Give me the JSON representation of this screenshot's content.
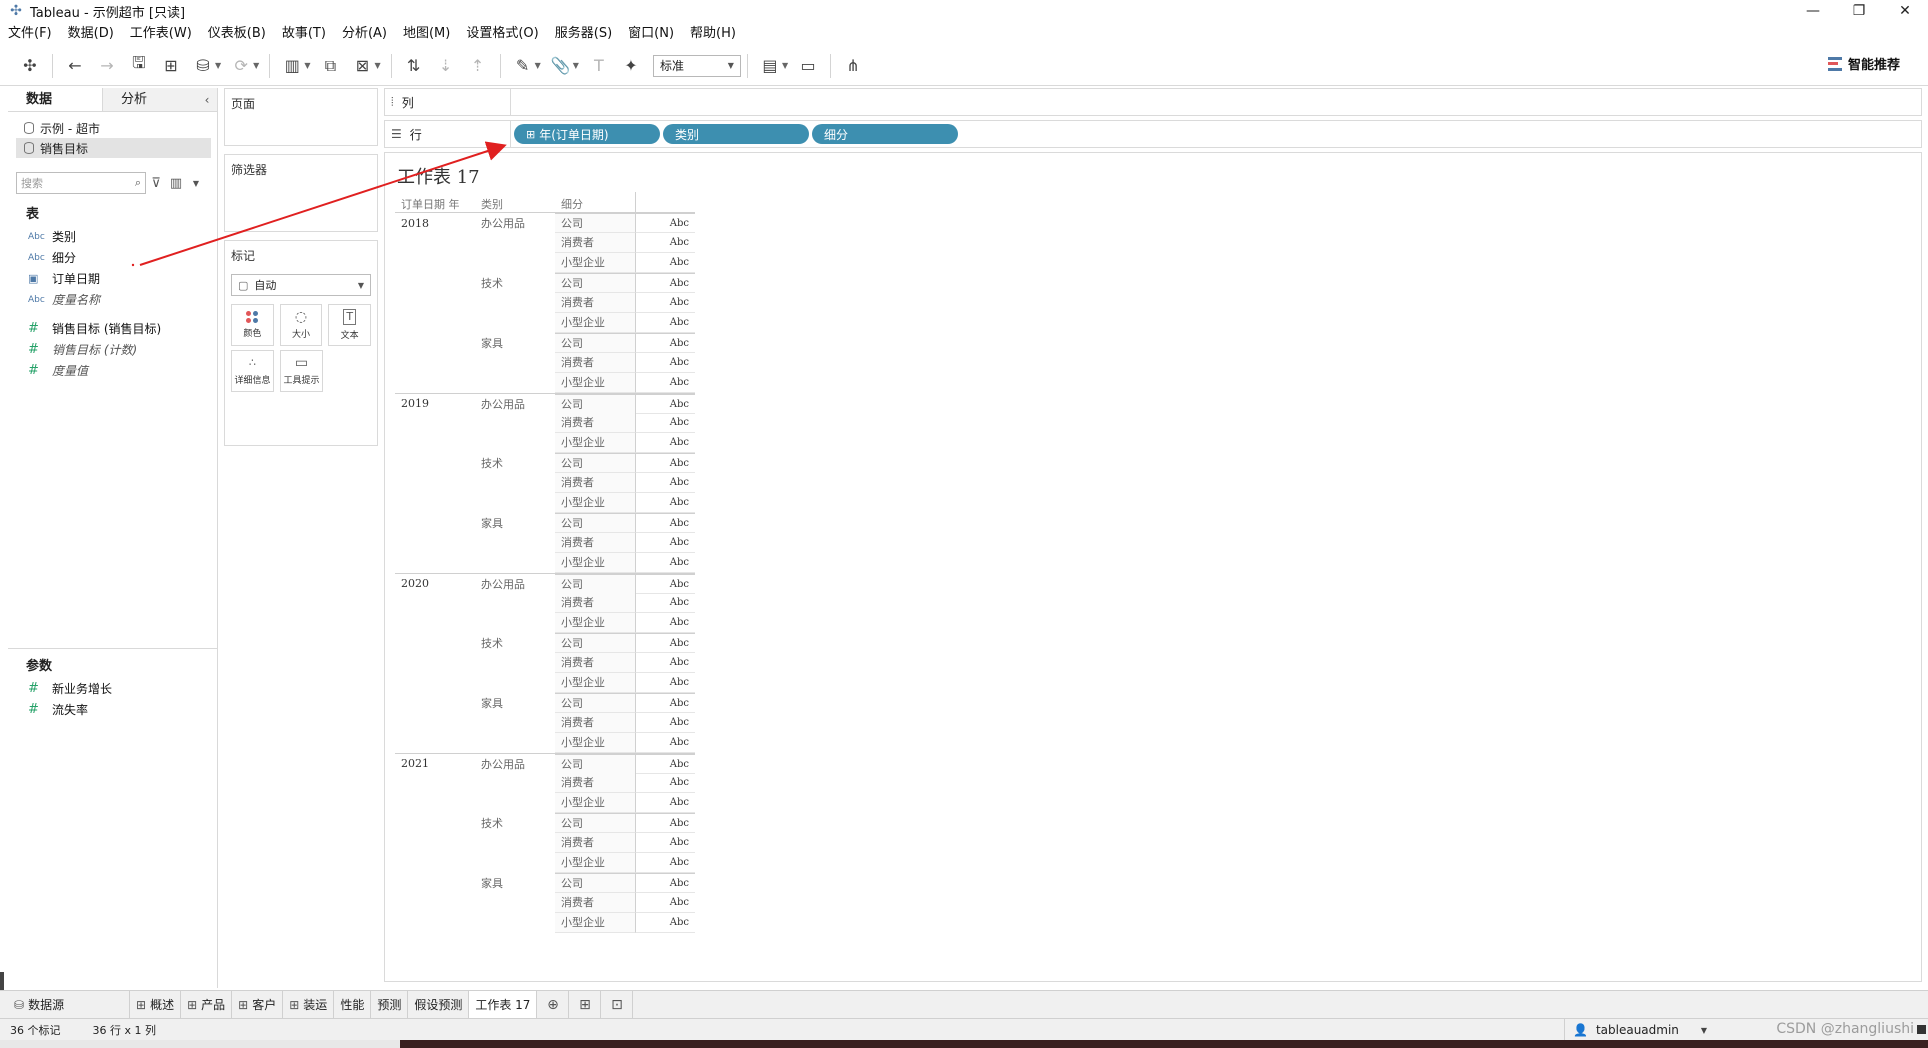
{
  "window": {
    "title": "Tableau - 示例超市 [只读]",
    "controls": [
      "—",
      "❐",
      "✕"
    ]
  },
  "menu": [
    "文件(F)",
    "数据(D)",
    "工作表(W)",
    "仪表板(B)",
    "故事(T)",
    "分析(A)",
    "地图(M)",
    "设置格式(O)",
    "服务器(S)",
    "窗口(N)",
    "帮助(H)"
  ],
  "toolbar": {
    "fit_value": "标准",
    "smart_recommend_label": "智能推荐"
  },
  "data_pane": {
    "tab_data": "数据",
    "tab_analysis": "分析",
    "collapse_glyph": "‹",
    "datasources": [
      "示例 - 超市",
      "销售目标"
    ],
    "search_placeholder": "搜索",
    "tables_header": "表",
    "fields": [
      {
        "type": "Abc",
        "label": "类别"
      },
      {
        "type": "Abc",
        "label": "细分"
      },
      {
        "type": "date",
        "label": "订单日期"
      },
      {
        "type": "Abc",
        "label": "度量名称"
      }
    ],
    "measures": [
      {
        "type": "#",
        "label": "销售目标 (销售目标)"
      },
      {
        "type": "#",
        "label": "销售目标 (计数)"
      },
      {
        "type": "#",
        "label": "度量值"
      }
    ],
    "params_header": "参数",
    "params": [
      {
        "type": "#",
        "label": "新业务增长"
      },
      {
        "type": "#",
        "label": "流失率"
      }
    ]
  },
  "shelves": {
    "pages_title": "页面",
    "filters_title": "筛选器",
    "marks_title": "标记",
    "mark_type": "自动",
    "mark_buttons": [
      "颜色",
      "大小",
      "文本",
      "详细信息",
      "工具提示"
    ],
    "columns_label": "列",
    "rows_label": "行",
    "row_pills": [
      "年(订单日期)",
      "类别",
      "细分"
    ]
  },
  "view": {
    "sheet_title": "工作表 17",
    "header": {
      "year": "订单日期 年",
      "category": "类别",
      "segment": "细分"
    },
    "years": [
      "2018",
      "2019",
      "2020",
      "2021"
    ],
    "categories": [
      "办公用品",
      "技术",
      "家具"
    ],
    "segments": [
      "公司",
      "消费者",
      "小型企业"
    ],
    "cell_value": "Abc"
  },
  "sheet_tabs": {
    "datasource": "数据源",
    "tabs": [
      "概述",
      "产品",
      "客户",
      "装运",
      "性能",
      "预测",
      "假设预测",
      "工作表 17"
    ]
  },
  "status": {
    "marks": "36 个标记",
    "dims": "36 行 x 1 列",
    "user": "tableauadmin",
    "watermark": "CSDN @zhangliushi"
  },
  "colors": {
    "pill": "#3d8fb0",
    "arrow": "#e02020",
    "measure_icon": "#26a269",
    "dimension_icon": "#4e79a7"
  }
}
